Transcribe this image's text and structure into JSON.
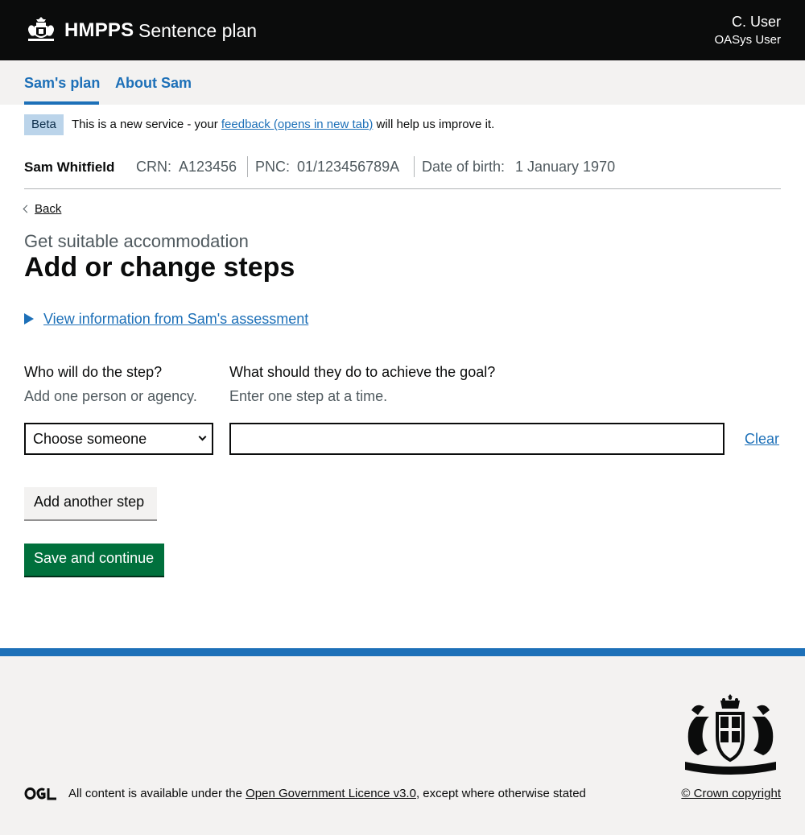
{
  "header": {
    "brand": "HMPPS",
    "service": "Sentence plan",
    "user_name": "C. User",
    "user_role": "OASys User"
  },
  "subnav": {
    "items": [
      {
        "label": "Sam's plan"
      },
      {
        "label": "About Sam"
      }
    ],
    "active_index": 0
  },
  "phase_banner": {
    "tag": "Beta",
    "text_before": "This is a new service - your ",
    "link": "feedback (opens in new tab)",
    "text_after": " will help us improve it."
  },
  "person": {
    "name": "Sam Whitfield",
    "crn_label": "CRN:",
    "crn": "A123456",
    "pnc_label": "PNC:",
    "pnc": "01/123456789A",
    "dob_label": "Date of birth:",
    "dob": "1 January 1970"
  },
  "back_link": "Back",
  "caption": "Get suitable accommodation",
  "title": "Add or change steps",
  "details_summary": "View information from Sam's assessment",
  "form": {
    "who_label": "Who will do the step?",
    "who_hint": "Add one person or agency.",
    "who_selected": "Choose someone",
    "what_label": "What should they do to achieve the goal?",
    "what_hint": "Enter one step at a time.",
    "what_value": "",
    "clear_link": "Clear",
    "add_button": "Add another step",
    "save_button": "Save and continue"
  },
  "footer": {
    "ogl": "OGL",
    "licence_before": "All content is available under the ",
    "licence_link": "Open Government Licence v3.0",
    "licence_after": ", except where otherwise stated",
    "copyright": "© Crown copyright"
  },
  "colors": {
    "header_bg": "#0b0c0c",
    "link": "#1d70b8",
    "primary_button": "#00703c",
    "footer_bg": "#f3f2f1",
    "beta_tag_bg": "#bbd4ea"
  }
}
